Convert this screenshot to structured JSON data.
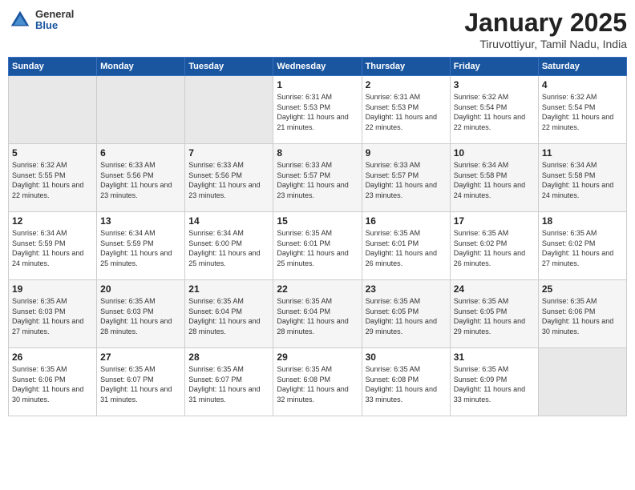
{
  "header": {
    "logo": {
      "general": "General",
      "blue": "Blue"
    },
    "title": "January 2025",
    "location": "Tiruvottiyur, Tamil Nadu, India"
  },
  "weekdays": [
    "Sunday",
    "Monday",
    "Tuesday",
    "Wednesday",
    "Thursday",
    "Friday",
    "Saturday"
  ],
  "weeks": [
    [
      {
        "day": "",
        "empty": true
      },
      {
        "day": "",
        "empty": true
      },
      {
        "day": "",
        "empty": true
      },
      {
        "day": "1",
        "sunrise": "Sunrise: 6:31 AM",
        "sunset": "Sunset: 5:53 PM",
        "daylight": "Daylight: 11 hours and 21 minutes."
      },
      {
        "day": "2",
        "sunrise": "Sunrise: 6:31 AM",
        "sunset": "Sunset: 5:53 PM",
        "daylight": "Daylight: 11 hours and 22 minutes."
      },
      {
        "day": "3",
        "sunrise": "Sunrise: 6:32 AM",
        "sunset": "Sunset: 5:54 PM",
        "daylight": "Daylight: 11 hours and 22 minutes."
      },
      {
        "day": "4",
        "sunrise": "Sunrise: 6:32 AM",
        "sunset": "Sunset: 5:54 PM",
        "daylight": "Daylight: 11 hours and 22 minutes."
      }
    ],
    [
      {
        "day": "5",
        "sunrise": "Sunrise: 6:32 AM",
        "sunset": "Sunset: 5:55 PM",
        "daylight": "Daylight: 11 hours and 22 minutes."
      },
      {
        "day": "6",
        "sunrise": "Sunrise: 6:33 AM",
        "sunset": "Sunset: 5:56 PM",
        "daylight": "Daylight: 11 hours and 23 minutes."
      },
      {
        "day": "7",
        "sunrise": "Sunrise: 6:33 AM",
        "sunset": "Sunset: 5:56 PM",
        "daylight": "Daylight: 11 hours and 23 minutes."
      },
      {
        "day": "8",
        "sunrise": "Sunrise: 6:33 AM",
        "sunset": "Sunset: 5:57 PM",
        "daylight": "Daylight: 11 hours and 23 minutes."
      },
      {
        "day": "9",
        "sunrise": "Sunrise: 6:33 AM",
        "sunset": "Sunset: 5:57 PM",
        "daylight": "Daylight: 11 hours and 23 minutes."
      },
      {
        "day": "10",
        "sunrise": "Sunrise: 6:34 AM",
        "sunset": "Sunset: 5:58 PM",
        "daylight": "Daylight: 11 hours and 24 minutes."
      },
      {
        "day": "11",
        "sunrise": "Sunrise: 6:34 AM",
        "sunset": "Sunset: 5:58 PM",
        "daylight": "Daylight: 11 hours and 24 minutes."
      }
    ],
    [
      {
        "day": "12",
        "sunrise": "Sunrise: 6:34 AM",
        "sunset": "Sunset: 5:59 PM",
        "daylight": "Daylight: 11 hours and 24 minutes."
      },
      {
        "day": "13",
        "sunrise": "Sunrise: 6:34 AM",
        "sunset": "Sunset: 5:59 PM",
        "daylight": "Daylight: 11 hours and 25 minutes."
      },
      {
        "day": "14",
        "sunrise": "Sunrise: 6:34 AM",
        "sunset": "Sunset: 6:00 PM",
        "daylight": "Daylight: 11 hours and 25 minutes."
      },
      {
        "day": "15",
        "sunrise": "Sunrise: 6:35 AM",
        "sunset": "Sunset: 6:01 PM",
        "daylight": "Daylight: 11 hours and 25 minutes."
      },
      {
        "day": "16",
        "sunrise": "Sunrise: 6:35 AM",
        "sunset": "Sunset: 6:01 PM",
        "daylight": "Daylight: 11 hours and 26 minutes."
      },
      {
        "day": "17",
        "sunrise": "Sunrise: 6:35 AM",
        "sunset": "Sunset: 6:02 PM",
        "daylight": "Daylight: 11 hours and 26 minutes."
      },
      {
        "day": "18",
        "sunrise": "Sunrise: 6:35 AM",
        "sunset": "Sunset: 6:02 PM",
        "daylight": "Daylight: 11 hours and 27 minutes."
      }
    ],
    [
      {
        "day": "19",
        "sunrise": "Sunrise: 6:35 AM",
        "sunset": "Sunset: 6:03 PM",
        "daylight": "Daylight: 11 hours and 27 minutes."
      },
      {
        "day": "20",
        "sunrise": "Sunrise: 6:35 AM",
        "sunset": "Sunset: 6:03 PM",
        "daylight": "Daylight: 11 hours and 28 minutes."
      },
      {
        "day": "21",
        "sunrise": "Sunrise: 6:35 AM",
        "sunset": "Sunset: 6:04 PM",
        "daylight": "Daylight: 11 hours and 28 minutes."
      },
      {
        "day": "22",
        "sunrise": "Sunrise: 6:35 AM",
        "sunset": "Sunset: 6:04 PM",
        "daylight": "Daylight: 11 hours and 28 minutes."
      },
      {
        "day": "23",
        "sunrise": "Sunrise: 6:35 AM",
        "sunset": "Sunset: 6:05 PM",
        "daylight": "Daylight: 11 hours and 29 minutes."
      },
      {
        "day": "24",
        "sunrise": "Sunrise: 6:35 AM",
        "sunset": "Sunset: 6:05 PM",
        "daylight": "Daylight: 11 hours and 29 minutes."
      },
      {
        "day": "25",
        "sunrise": "Sunrise: 6:35 AM",
        "sunset": "Sunset: 6:06 PM",
        "daylight": "Daylight: 11 hours and 30 minutes."
      }
    ],
    [
      {
        "day": "26",
        "sunrise": "Sunrise: 6:35 AM",
        "sunset": "Sunset: 6:06 PM",
        "daylight": "Daylight: 11 hours and 30 minutes."
      },
      {
        "day": "27",
        "sunrise": "Sunrise: 6:35 AM",
        "sunset": "Sunset: 6:07 PM",
        "daylight": "Daylight: 11 hours and 31 minutes."
      },
      {
        "day": "28",
        "sunrise": "Sunrise: 6:35 AM",
        "sunset": "Sunset: 6:07 PM",
        "daylight": "Daylight: 11 hours and 31 minutes."
      },
      {
        "day": "29",
        "sunrise": "Sunrise: 6:35 AM",
        "sunset": "Sunset: 6:08 PM",
        "daylight": "Daylight: 11 hours and 32 minutes."
      },
      {
        "day": "30",
        "sunrise": "Sunrise: 6:35 AM",
        "sunset": "Sunset: 6:08 PM",
        "daylight": "Daylight: 11 hours and 33 minutes."
      },
      {
        "day": "31",
        "sunrise": "Sunrise: 6:35 AM",
        "sunset": "Sunset: 6:09 PM",
        "daylight": "Daylight: 11 hours and 33 minutes."
      },
      {
        "day": "",
        "empty": true
      }
    ]
  ]
}
